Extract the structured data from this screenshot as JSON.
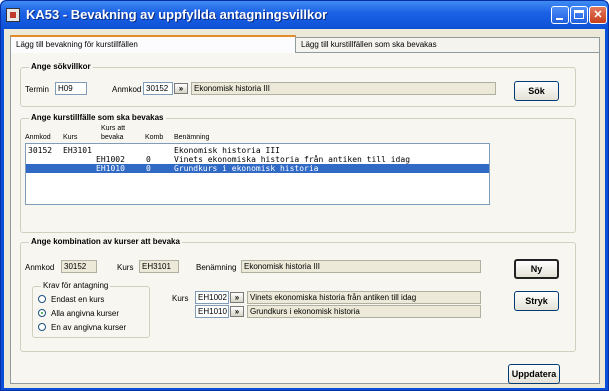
{
  "window": {
    "title": "KA53 - Bevakning av uppfyllda antagningsvillkor"
  },
  "tabs": [
    {
      "label": "Lägg till bevakning för kurstillfällen",
      "active": true
    },
    {
      "label": "Lägg till kurstillfällen som ska bevakas",
      "active": false
    }
  ],
  "search": {
    "title": "Ange sökvillkor",
    "termin_label": "Termin",
    "termin_value": "H09",
    "anmkod_label": "Anmkod",
    "anmkod_value": "30152",
    "lookup_label": "»",
    "description": "Ekonomisk historia III",
    "search_button": "Sök"
  },
  "course_list": {
    "title": "Ange kurstillfälle som ska bevakas",
    "headers": {
      "anmkod": "Anmkod",
      "kurs": "Kurs",
      "kurs_att_bevaka_1": "Kurs att",
      "kurs_att_bevaka_2": "bevaka",
      "komb": "Komb",
      "benamning": "Benämning"
    },
    "rows": [
      {
        "anmkod": "30152",
        "kurs": "EH3101",
        "bevaka": "",
        "komb": "",
        "benamning": "Ekonomisk historia III",
        "selected": false
      },
      {
        "anmkod": "",
        "kurs": "",
        "bevaka": "EH1002",
        "komb": "0",
        "benamning": "Vinets ekonomiska historia från antiken till idag",
        "selected": false
      },
      {
        "anmkod": "",
        "kurs": "",
        "bevaka": "EH1010",
        "komb": "0",
        "benamning": "Grundkurs i ekonomisk historia",
        "selected": true
      }
    ]
  },
  "combination": {
    "title": "Ange kombination av kurser att bevaka",
    "anmkod_label": "Anmkod",
    "anmkod_value": "30152",
    "kurs_label": "Kurs",
    "kurs_value": "EH3101",
    "benamning_label": "Benämning",
    "benamning_value": "Ekonomisk historia III",
    "requirement": {
      "title": "Krav för antagning",
      "options": [
        {
          "label": "Endast en kurs",
          "selected": false
        },
        {
          "label": "Alla angivna kurser",
          "selected": true
        },
        {
          "label": "En av angivna kurser",
          "selected": false
        }
      ]
    },
    "kurs_list_label": "Kurs",
    "courses": [
      {
        "code": "EH1002",
        "lookup": "»",
        "name": "Vinets ekonomiska historia från antiken till idag"
      },
      {
        "code": "EH1010",
        "lookup": "»",
        "name": "Grundkurs i ekonomisk historia"
      }
    ],
    "new_button": "Ny",
    "delete_button": "Stryk"
  },
  "update_button": "Uppdatera"
}
